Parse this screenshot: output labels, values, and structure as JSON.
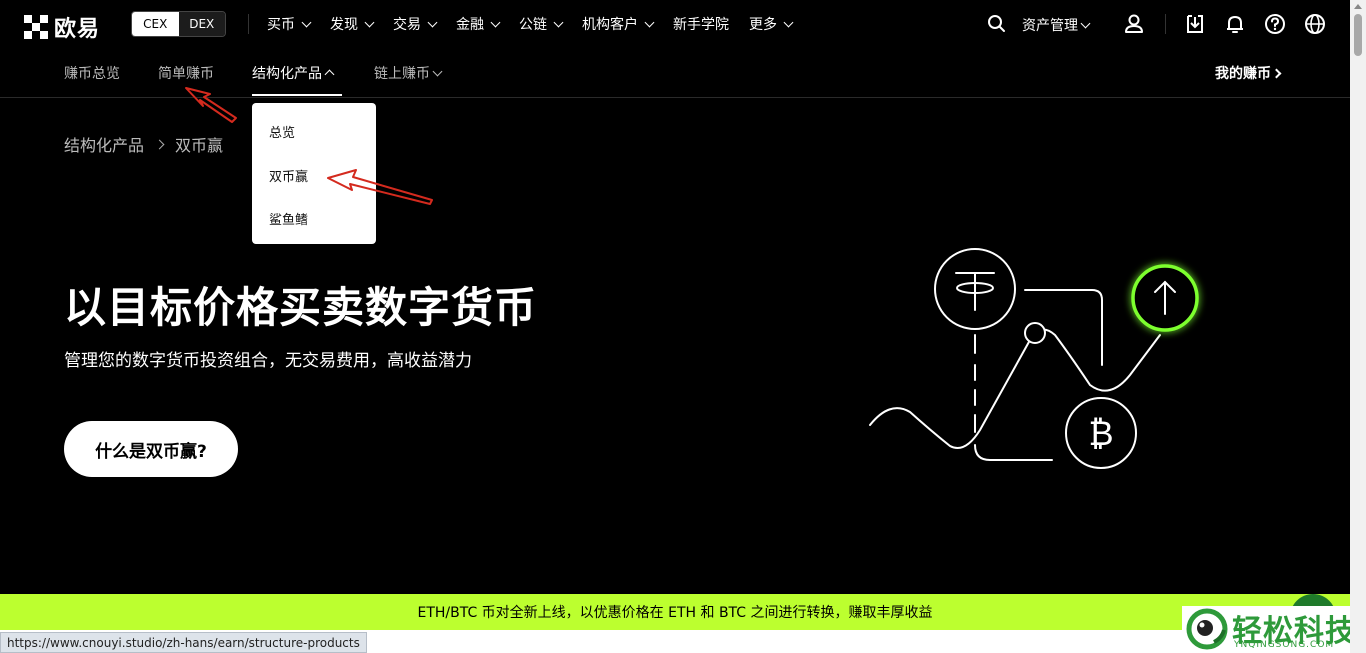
{
  "brand": {
    "name": "欧易"
  },
  "mode_toggle": {
    "cex": "CEX",
    "dex": "DEX"
  },
  "main_menu": [
    {
      "label": "买币",
      "dropdown": true
    },
    {
      "label": "发现",
      "dropdown": true
    },
    {
      "label": "交易",
      "dropdown": true
    },
    {
      "label": "金融",
      "dropdown": true
    },
    {
      "label": "公链",
      "dropdown": true
    },
    {
      "label": "机构客户",
      "dropdown": true
    },
    {
      "label": "新手学院",
      "dropdown": false
    },
    {
      "label": "更多",
      "dropdown": true
    }
  ],
  "right_nav": {
    "assets_label": "资产管理",
    "icons": [
      "search-icon",
      "user-icon",
      "download-icon",
      "bell-icon",
      "help-icon",
      "globe-icon"
    ]
  },
  "sub_nav": {
    "items": [
      "赚币总览",
      "简单赚币",
      "结构化产品",
      "链上赚币"
    ],
    "active": "结构化产品",
    "my_earn": "我的赚币"
  },
  "dropdown": {
    "items": [
      "总览",
      "双币赢",
      "鲨鱼鳍"
    ]
  },
  "breadcrumb": {
    "parent": "结构化产品",
    "current": "双币赢"
  },
  "hero": {
    "title": "以目标价格买卖数字货币",
    "subtitle": "管理您的数字货币投资组合，无交易费用，高收益潜力",
    "cta": "什么是双币赢?"
  },
  "banner": {
    "text": "ETH/BTC 币对全新上线，以优惠价格在 ETH 和 BTC 之间进行转换，赚取丰厚收益"
  },
  "status_url": "https://www.cnouyi.studio/zh-hans/earn/structure-products",
  "watermark": {
    "title": "轻松科技",
    "subtitle": "YNQINGSONG.COM"
  },
  "colors": {
    "accent": "#bcff2f",
    "glow": "#7dff2f",
    "arrow": "#d42a1e"
  }
}
